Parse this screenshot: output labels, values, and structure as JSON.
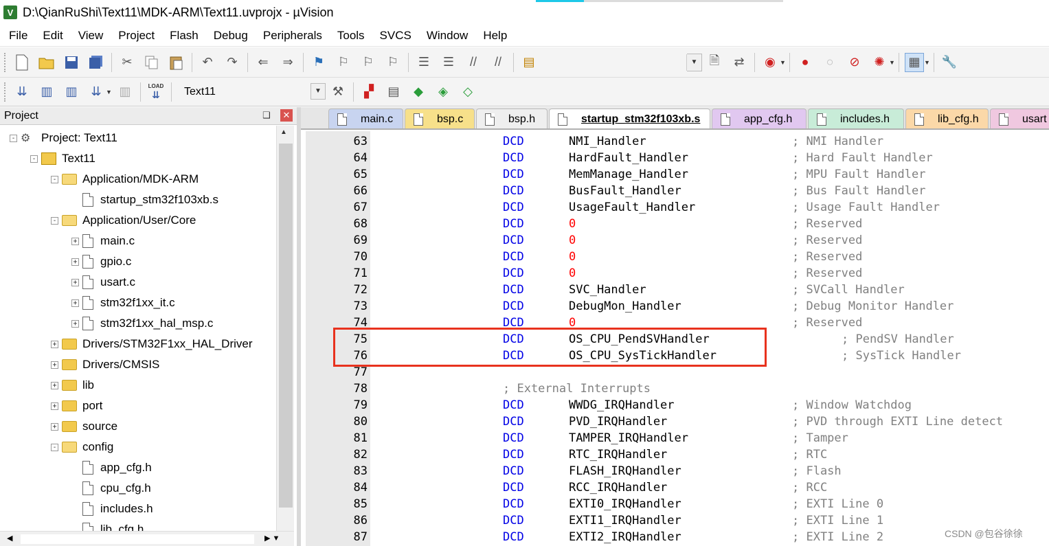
{
  "window": {
    "title": "D:\\QianRuShi\\Text11\\MDK-ARM\\Text11.uvprojx - µVision",
    "app_icon_letter": "V"
  },
  "menu": [
    "File",
    "Edit",
    "View",
    "Project",
    "Flash",
    "Debug",
    "Peripherals",
    "Tools",
    "SVCS",
    "Window",
    "Help"
  ],
  "toolbar2": {
    "load_label": "LOAD",
    "target": "Text11"
  },
  "project_pane": {
    "title": "Project",
    "pin": "❑",
    "close": "✕",
    "tree": [
      {
        "label": "Project: Text11",
        "kind": "project",
        "expander": "-"
      },
      {
        "label": "Text11",
        "kind": "target",
        "expander": "-"
      },
      {
        "label": "Application/MDK-ARM",
        "kind": "folder-open",
        "expander": "-"
      },
      {
        "label": "startup_stm32f103xb.s",
        "kind": "file",
        "expander": ""
      },
      {
        "label": "Application/User/Core",
        "kind": "folder-open",
        "expander": "-"
      },
      {
        "label": "main.c",
        "kind": "file",
        "expander": "+"
      },
      {
        "label": "gpio.c",
        "kind": "file",
        "expander": "+"
      },
      {
        "label": "usart.c",
        "kind": "file",
        "expander": "+"
      },
      {
        "label": "stm32f1xx_it.c",
        "kind": "file",
        "expander": "+"
      },
      {
        "label": "stm32f1xx_hal_msp.c",
        "kind": "file",
        "expander": "+"
      },
      {
        "label": "Drivers/STM32F1xx_HAL_Driver",
        "kind": "folder",
        "expander": "+"
      },
      {
        "label": "Drivers/CMSIS",
        "kind": "folder",
        "expander": "+"
      },
      {
        "label": "lib",
        "kind": "folder",
        "expander": "+"
      },
      {
        "label": "port",
        "kind": "folder",
        "expander": "+"
      },
      {
        "label": "source",
        "kind": "folder",
        "expander": "+"
      },
      {
        "label": "config",
        "kind": "folder-open",
        "expander": "-"
      },
      {
        "label": "app_cfg.h",
        "kind": "file",
        "expander": ""
      },
      {
        "label": "cpu_cfg.h",
        "kind": "file",
        "expander": ""
      },
      {
        "label": "includes.h",
        "kind": "file",
        "expander": ""
      },
      {
        "label": "lib_cfg.h",
        "kind": "file",
        "expander": ""
      }
    ]
  },
  "tabs": [
    {
      "label": "main.c",
      "color": "#c8d4f0",
      "active": false
    },
    {
      "label": "bsp.c",
      "color": "#f7e08a",
      "active": false
    },
    {
      "label": "bsp.h",
      "color": "#efefef",
      "active": false
    },
    {
      "label": "startup_stm32f103xb.s",
      "color": "#ffffff",
      "active": true
    },
    {
      "label": "app_cfg.h",
      "color": "#e1c8f0",
      "active": false
    },
    {
      "label": "includes.h",
      "color": "#c8ecd8",
      "active": false
    },
    {
      "label": "lib_cfg.h",
      "color": "#fbd8a8",
      "active": false
    },
    {
      "label": "usart",
      "color": "#f0c8e0",
      "active": false
    }
  ],
  "code": [
    {
      "ln": "63",
      "kw": "DCD",
      "op": "NMI_Handler",
      "cm": "; NMI Handler"
    },
    {
      "ln": "64",
      "kw": "DCD",
      "op": "HardFault_Handler",
      "cm": "; Hard Fault Handler"
    },
    {
      "ln": "65",
      "kw": "DCD",
      "op": "MemManage_Handler",
      "cm": "; MPU Fault Handler"
    },
    {
      "ln": "66",
      "kw": "DCD",
      "op": "BusFault_Handler",
      "cm": "; Bus Fault Handler"
    },
    {
      "ln": "67",
      "kw": "DCD",
      "op": "UsageFault_Handler",
      "cm": "; Usage Fault Handler"
    },
    {
      "ln": "68",
      "kw": "DCD",
      "op": "0",
      "num": true,
      "cm": "; Reserved"
    },
    {
      "ln": "69",
      "kw": "DCD",
      "op": "0",
      "num": true,
      "cm": "; Reserved"
    },
    {
      "ln": "70",
      "kw": "DCD",
      "op": "0",
      "num": true,
      "cm": "; Reserved"
    },
    {
      "ln": "71",
      "kw": "DCD",
      "op": "0",
      "num": true,
      "cm": "; Reserved"
    },
    {
      "ln": "72",
      "kw": "DCD",
      "op": "SVC_Handler",
      "cm": "; SVCall Handler"
    },
    {
      "ln": "73",
      "kw": "DCD",
      "op": "DebugMon_Handler",
      "cm": "; Debug Monitor Handler"
    },
    {
      "ln": "74",
      "kw": "DCD",
      "op": "0",
      "num": true,
      "cm": "; Reserved"
    },
    {
      "ln": "75",
      "kw": "DCD",
      "op": "OS_CPU_PendSVHandler",
      "cm": "; PendSV Handler",
      "indent": true
    },
    {
      "ln": "76",
      "kw": "DCD",
      "op": "OS_CPU_SysTickHandler",
      "cm": "; SysTick Handler",
      "indent": true
    },
    {
      "ln": "77",
      "kw": "",
      "op": "",
      "cm": ""
    },
    {
      "ln": "78",
      "kw": "",
      "op": "",
      "cm": "; External Interrupts",
      "head": true
    },
    {
      "ln": "79",
      "kw": "DCD",
      "op": "WWDG_IRQHandler",
      "cm": "; Window Watchdog"
    },
    {
      "ln": "80",
      "kw": "DCD",
      "op": "PVD_IRQHandler",
      "cm": "; PVD through EXTI Line detect"
    },
    {
      "ln": "81",
      "kw": "DCD",
      "op": "TAMPER_IRQHandler",
      "cm": "; Tamper"
    },
    {
      "ln": "82",
      "kw": "DCD",
      "op": "RTC_IRQHandler",
      "cm": "; RTC"
    },
    {
      "ln": "83",
      "kw": "DCD",
      "op": "FLASH_IRQHandler",
      "cm": "; Flash"
    },
    {
      "ln": "84",
      "kw": "DCD",
      "op": "RCC_IRQHandler",
      "cm": "; RCC"
    },
    {
      "ln": "85",
      "kw": "DCD",
      "op": "EXTI0_IRQHandler",
      "cm": "; EXTI Line 0"
    },
    {
      "ln": "86",
      "kw": "DCD",
      "op": "EXTI1_IRQHandler",
      "cm": "; EXTI Line 1"
    },
    {
      "ln": "87",
      "kw": "DCD",
      "op": "EXTI2_IRQHandler",
      "cm": "; EXTI Line 2"
    }
  ],
  "colors": {
    "keyword": "#0000e6",
    "number": "#ff0000",
    "comment": "#808080",
    "highlight": "#e8321e"
  },
  "watermark": "CSDN @包谷徐徐"
}
